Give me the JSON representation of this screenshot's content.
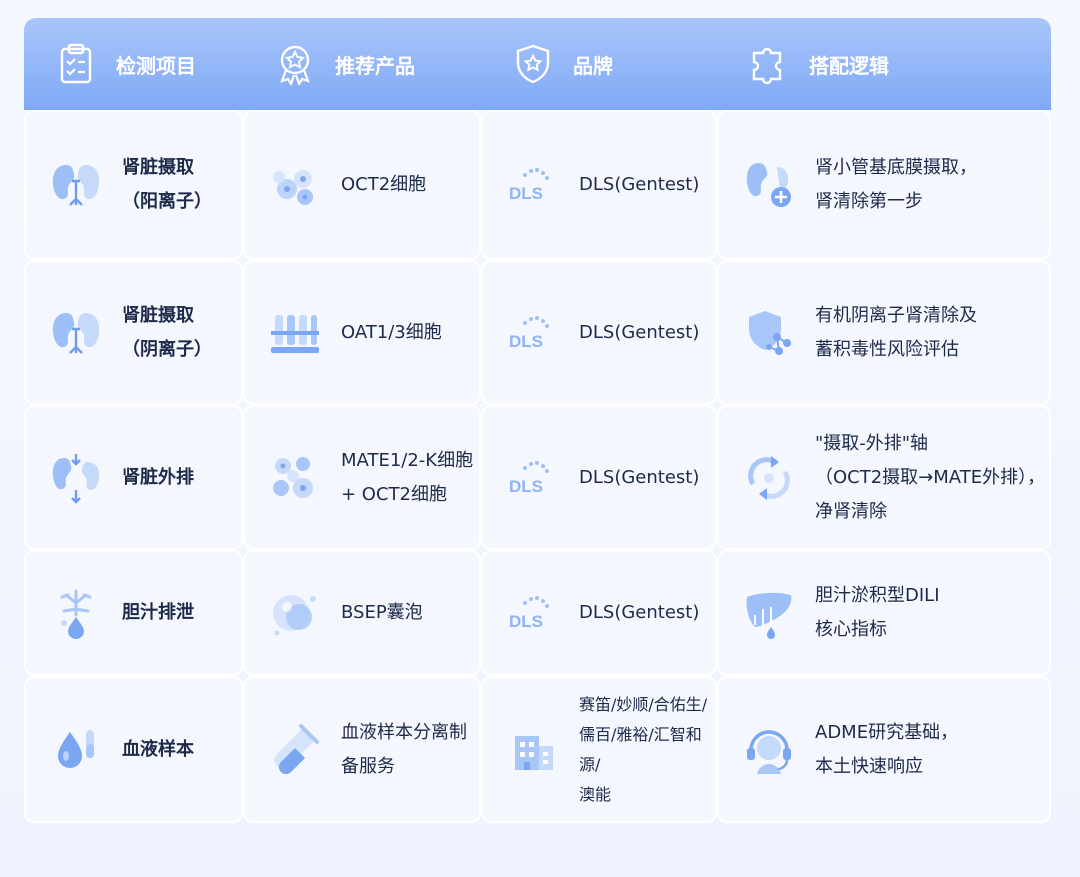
{
  "header": [
    {
      "label": "检测项目",
      "icon": "clipboard-check-icon"
    },
    {
      "label": "推荐产品",
      "icon": "award-badge-icon"
    },
    {
      "label": "品牌",
      "icon": "shield-star-icon"
    },
    {
      "label": "搭配逻辑",
      "icon": "puzzle-icon"
    }
  ],
  "rows": [
    {
      "item": "肾脏摄取\n（阳离子）",
      "product": "OCT2细胞",
      "brand": "DLS(Gentest)",
      "logic": "肾小管基底膜摄取，\n肾清除第一步"
    },
    {
      "item": "肾脏摄取\n（阴离子）",
      "product": "OAT1/3细胞",
      "brand": "DLS(Gentest)",
      "logic": "有机阴离子肾清除及\n蓄积毒性风险评估"
    },
    {
      "item": "肾脏外排",
      "product": "MATE1/2-K细胞\n+ OCT2细胞",
      "brand": "DLS(Gentest)",
      "logic": "\"摄取-外排\"轴\n（OCT2摄取→MATE外排），\n净肾清除"
    },
    {
      "item": "胆汁排泄",
      "product": "BSEP囊泡",
      "brand": "DLS(Gentest)",
      "logic": "胆汁淤积型DILI\n核心指标"
    },
    {
      "item": "血液样本",
      "product": "血液样本分离制\n备服务",
      "brand": "赛笛/妙顺/合佑生/\n儒百/雅裕/汇智和源/\n澳能",
      "logic": "ADME研究基础，\n本土快速响应"
    }
  ],
  "logo_text": "DLS",
  "colors": {
    "header": "#8db2f7",
    "icon": "#7aa6f2",
    "cell": "#f4f7fd",
    "text": "#1d2a4a"
  }
}
